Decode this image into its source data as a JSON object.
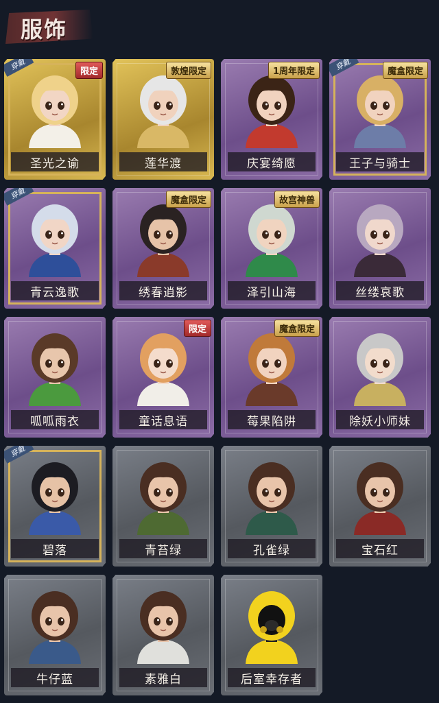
{
  "header": {
    "title": "服饰"
  },
  "equipped_label": "穿戴",
  "costumes": [
    {
      "name": "圣光之谕",
      "tier": "gold",
      "badge": "限定",
      "badge_style": "red",
      "equipped": true,
      "hair": "#efd28a",
      "outfit": "#f3f0e8",
      "skin": "#f2d6c4"
    },
    {
      "name": "莲华渡",
      "tier": "gold",
      "badge": "敦煌限定",
      "badge_style": "gold",
      "equipped": false,
      "hair": "#e6e6e6",
      "outfit": "#d9b866",
      "skin": "#f0d2bd"
    },
    {
      "name": "庆宴绮愿",
      "tier": "purple",
      "badge": "1周年限定",
      "badge_style": "gold",
      "equipped": false,
      "hair": "#3b2416",
      "outfit": "#c23a2e",
      "skin": "#f1d3bf"
    },
    {
      "name": "王子与骑士",
      "tier": "purple",
      "badge": "魔盒限定",
      "badge_style": "gold",
      "equipped": true,
      "hair": "#d8b065",
      "outfit": "#6d7da8",
      "skin": "#f1d3bf"
    },
    {
      "name": "青云逸歌",
      "tier": "purple",
      "badge": "",
      "badge_style": "",
      "equipped": true,
      "hair": "#d4dcea",
      "outfit": "#2e4f9a",
      "skin": "#f1d6c6"
    },
    {
      "name": "绣春逍影",
      "tier": "purple",
      "badge": "魔盒限定",
      "badge_style": "gold",
      "equipped": false,
      "hair": "#2a2222",
      "outfit": "#8a3a2a",
      "skin": "#e6c3a8"
    },
    {
      "name": "泽引山海",
      "tier": "purple",
      "badge": "故宫神兽",
      "badge_style": "gold",
      "equipped": false,
      "hair": "#cfd8d0",
      "outfit": "#2f8a4a",
      "skin": "#f0d4c0"
    },
    {
      "name": "丝缕哀歌",
      "tier": "purple",
      "badge": "",
      "badge_style": "",
      "equipped": false,
      "hair": "#b8a8c0",
      "outfit": "#3a2a38",
      "skin": "#f0d8cc"
    },
    {
      "name": "呱呱雨衣",
      "tier": "purple",
      "badge": "",
      "badge_style": "",
      "equipped": false,
      "hair": "#5a3a28",
      "outfit": "#4b9a3e",
      "skin": "#e8c6ac"
    },
    {
      "name": "童话息语",
      "tier": "purple",
      "badge": "限定",
      "badge_style": "red",
      "equipped": false,
      "hair": "#e2a060",
      "outfit": "#f1eee8",
      "skin": "#f4dccc"
    },
    {
      "name": "莓果陷阱",
      "tier": "purple",
      "badge": "魔盒限定",
      "badge_style": "gold",
      "equipped": false,
      "hair": "#c07a3a",
      "outfit": "#6a3a2a",
      "skin": "#f1d3bf"
    },
    {
      "name": "除妖小师妹",
      "tier": "purple",
      "badge": "",
      "badge_style": "",
      "equipped": false,
      "hair": "#c8c8c8",
      "outfit": "#c8b060",
      "skin": "#f2dccc"
    },
    {
      "name": "碧落",
      "tier": "gray",
      "badge": "",
      "badge_style": "",
      "equipped": true,
      "hair": "#1c1c22",
      "outfit": "#3a5aa8",
      "skin": "#e6c2a6"
    },
    {
      "name": "青苔绿",
      "tier": "gray",
      "badge": "",
      "badge_style": "",
      "equipped": false,
      "hair": "#4a2e22",
      "outfit": "#4e6a32",
      "skin": "#e8c4aa"
    },
    {
      "name": "孔雀绿",
      "tier": "gray",
      "badge": "",
      "badge_style": "",
      "equipped": false,
      "hair": "#4a2e22",
      "outfit": "#2e5a4a",
      "skin": "#e8c4aa"
    },
    {
      "name": "宝石红",
      "tier": "gray",
      "badge": "",
      "badge_style": "",
      "equipped": false,
      "hair": "#4a2e22",
      "outfit": "#8a2a26",
      "skin": "#e8c4aa"
    },
    {
      "name": "牛仔蓝",
      "tier": "gray",
      "badge": "",
      "badge_style": "",
      "equipped": false,
      "hair": "#4a2e22",
      "outfit": "#3a5a8a",
      "skin": "#e8c4aa"
    },
    {
      "name": "素雅白",
      "tier": "gray",
      "badge": "",
      "badge_style": "",
      "equipped": false,
      "hair": "#4a2e22",
      "outfit": "#e0e0dc",
      "skin": "#e8c4aa"
    },
    {
      "name": "后室幸存者",
      "tier": "gray",
      "badge": "",
      "badge_style": "",
      "equipped": false,
      "hair": "#f2d21e",
      "outfit": "#f2d21e",
      "skin": "#111111",
      "masked": true
    }
  ]
}
